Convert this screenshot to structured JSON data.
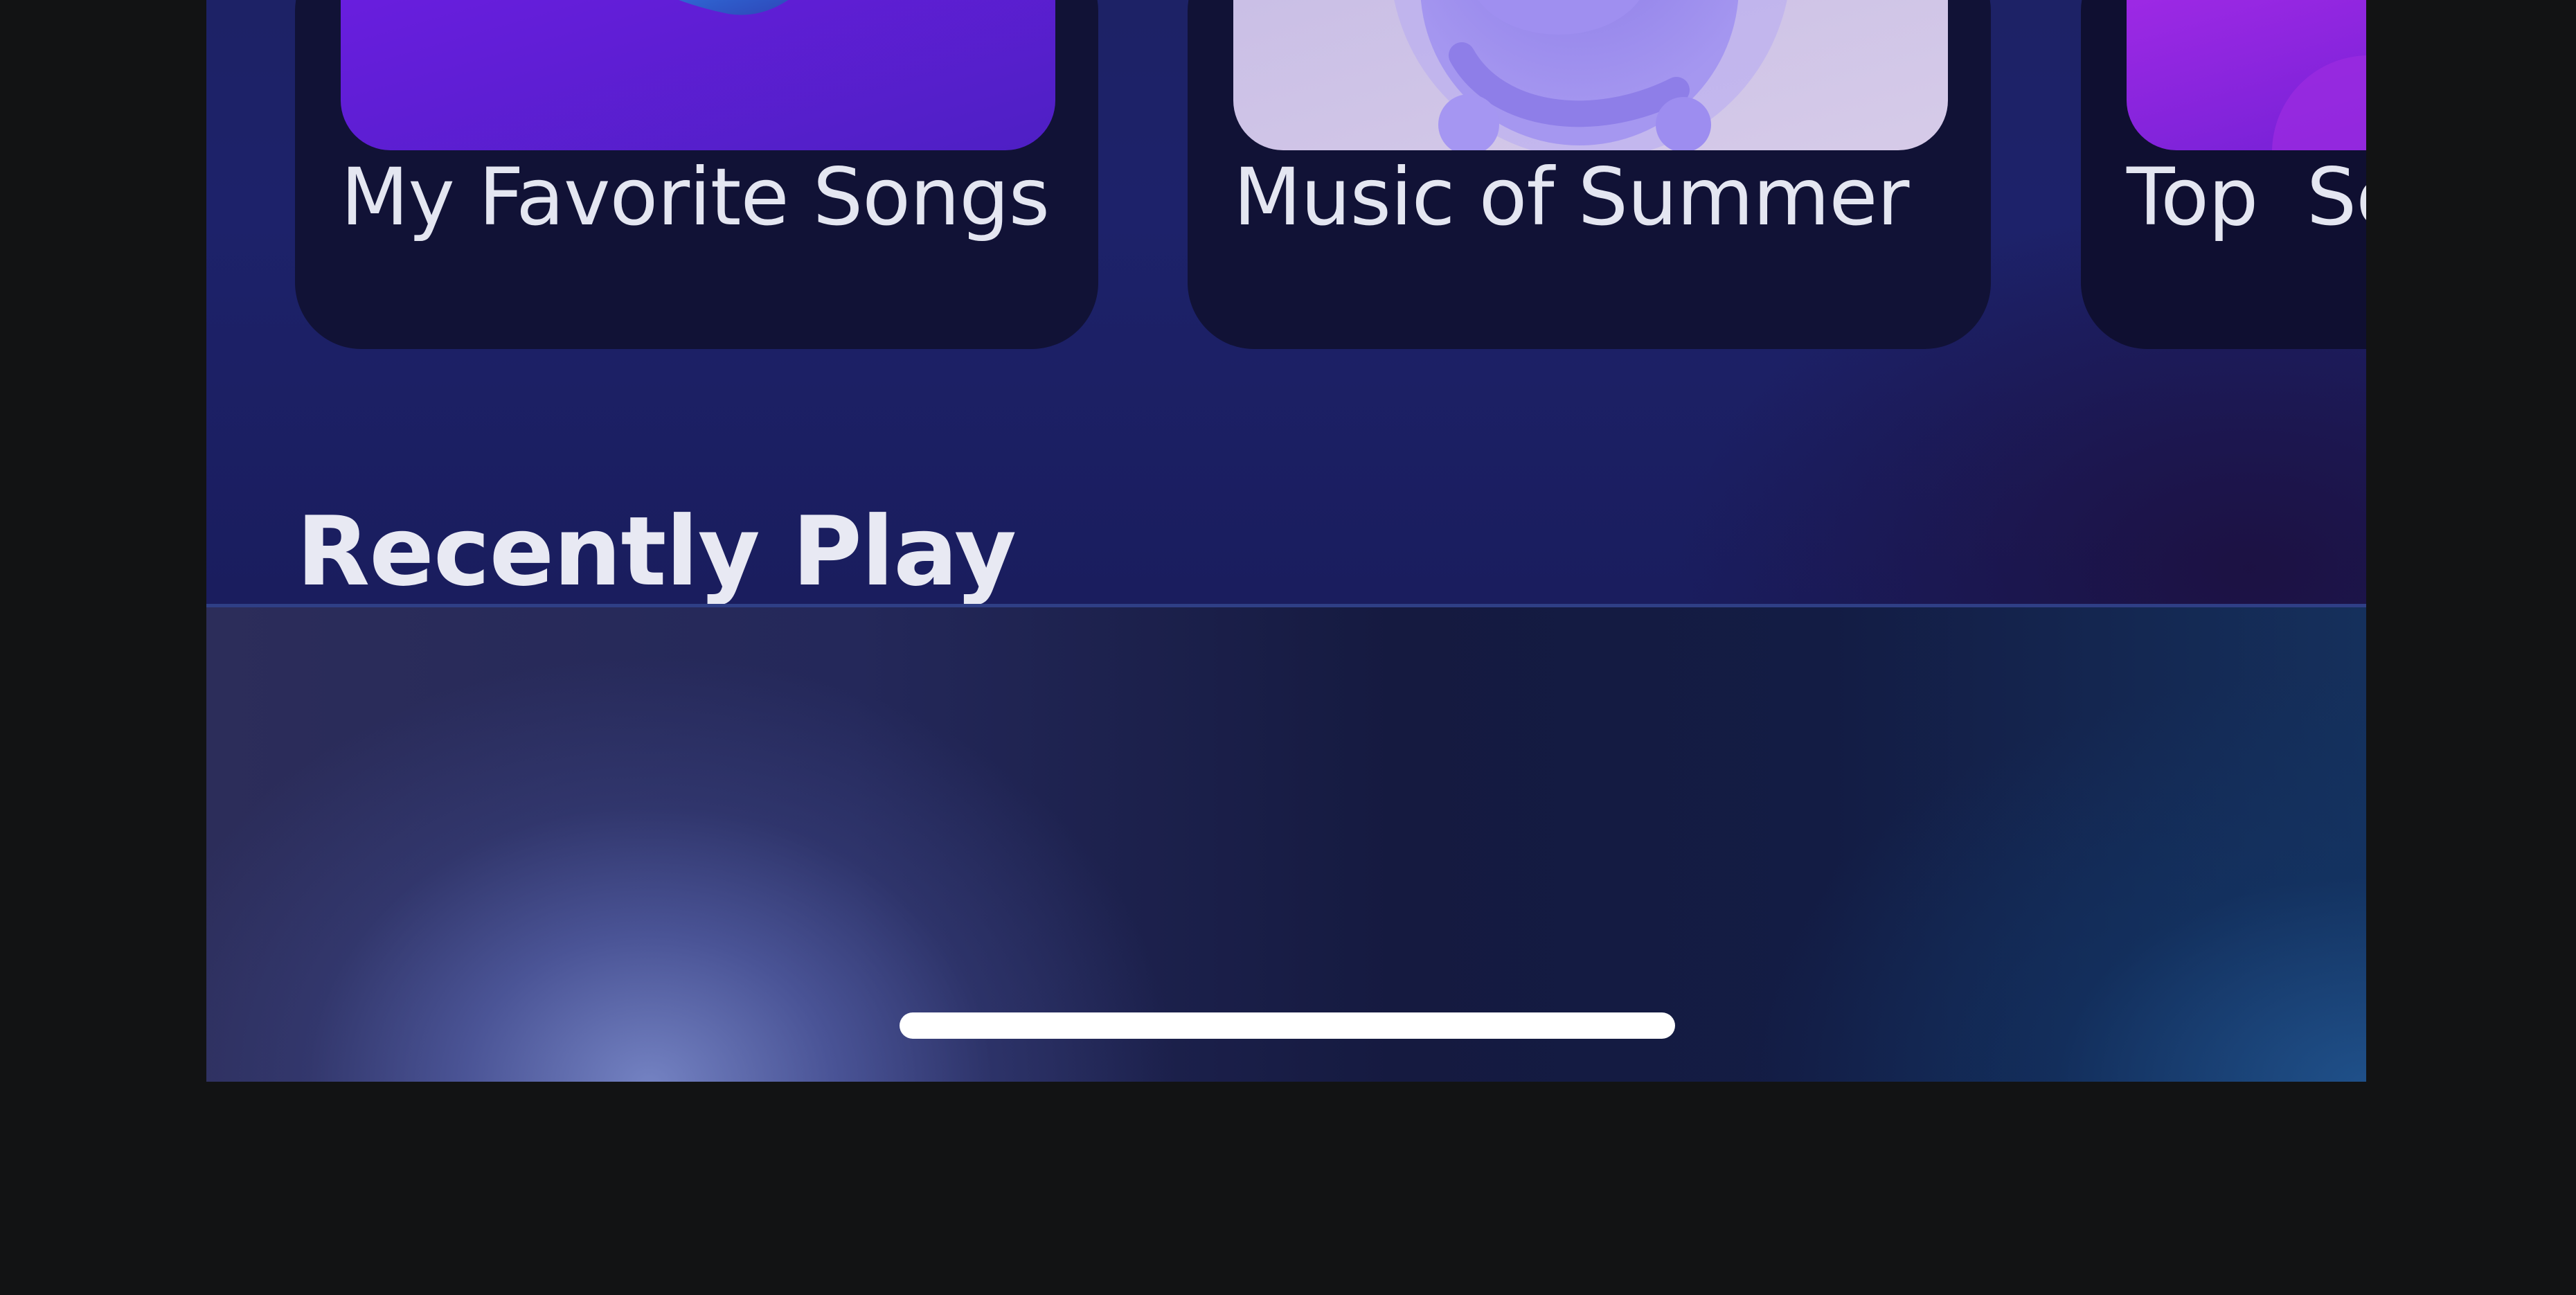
{
  "playlists": [
    {
      "title": "My Favorite Songs",
      "art": "purple-swirl-art"
    },
    {
      "title": "Music of Summer",
      "art": "lavender-orb-art"
    },
    {
      "title": "Top  Songs",
      "art": "magenta-gradient-art"
    }
  ],
  "sections": {
    "recently_played_title": "Recently Play"
  },
  "colors": {
    "background": "#1d2266",
    "card": "#111236",
    "text": "#e4e6f1",
    "accent_purple": "#6a1fe0",
    "accent_lavender": "#b9a8ee",
    "accent_magenta": "#b42ae6"
  }
}
